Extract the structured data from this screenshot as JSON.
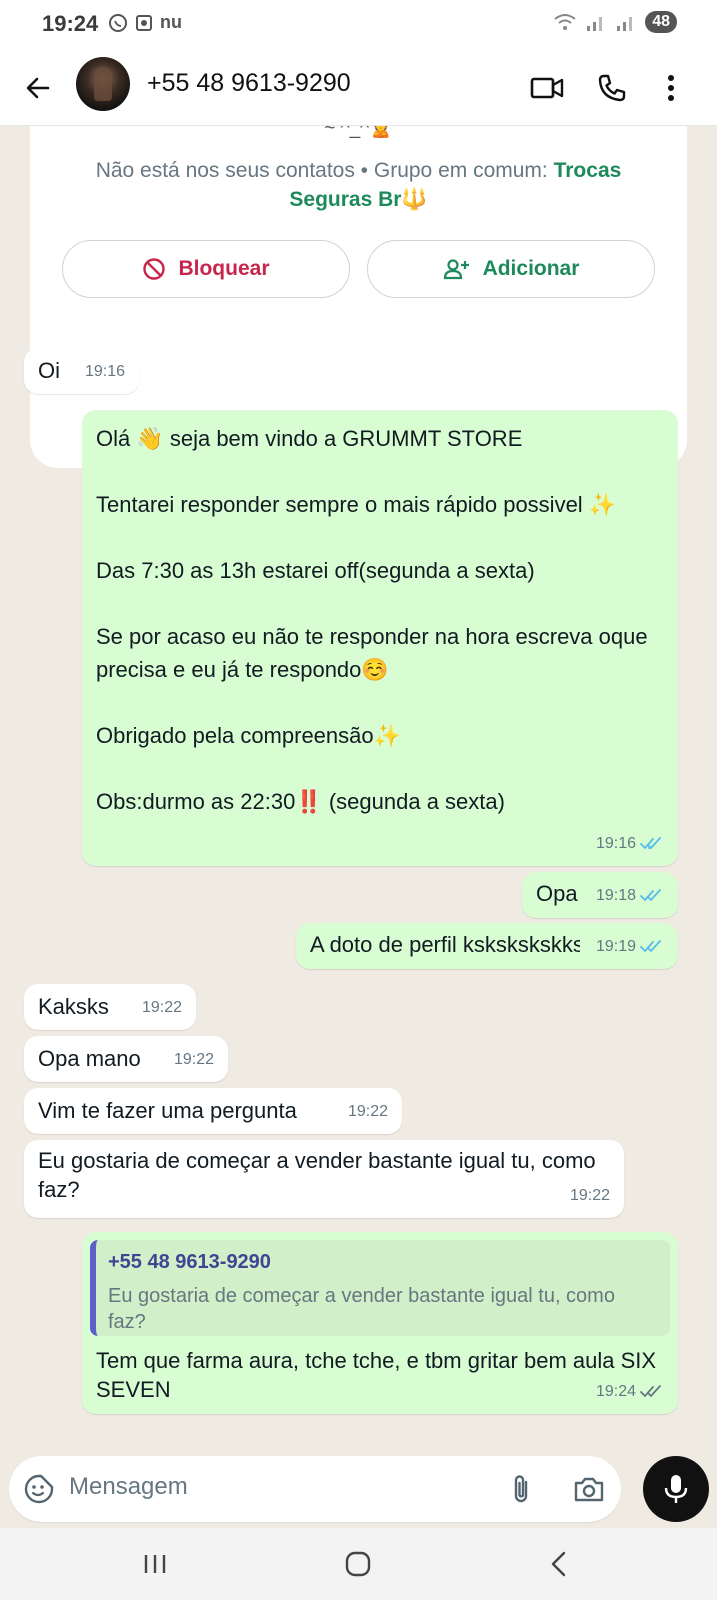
{
  "status_bar": {
    "time": "19:24",
    "carrier_text": "nu",
    "battery": "48"
  },
  "header": {
    "contact_name": "+55 48 9613-9290"
  },
  "info_card": {
    "emoticon": "~ ^_^🙎",
    "not_in_contacts": "Não está nos seus contatos • Grupo em comum: ",
    "group_name": "Trocas Seguras Br🔱",
    "block_label": "Bloquear",
    "add_label": "Adicionar"
  },
  "messages": [
    {
      "dir": "in",
      "text": "Oi",
      "time": "19:16"
    },
    {
      "dir": "out",
      "text": "Olá 👋 seja bem vindo a GRUMMT STORE\n\nTentarei responder sempre o mais rápido possivel ✨\n\nDas 7:30 as 13h estarei off(segunda a sexta)\n\nSe por acaso eu não te responder na hora escreva oque precisa e eu já te respondo☺️\n\nObrigado pela compreensão✨\n\nObs:durmo as 22:30‼️ (segunda a sexta)",
      "time": "19:16",
      "status": "read"
    },
    {
      "dir": "out",
      "text": "Opa",
      "time": "19:18",
      "status": "read"
    },
    {
      "dir": "out",
      "text": "A doto de perfil kskskskskks",
      "time": "19:19",
      "status": "read"
    },
    {
      "dir": "in",
      "text": "Kaksks",
      "time": "19:22"
    },
    {
      "dir": "in",
      "text": "Opa mano",
      "time": "19:22"
    },
    {
      "dir": "in",
      "text": "Vim te fazer uma pergunta",
      "time": "19:22"
    },
    {
      "dir": "in",
      "text": "Eu gostaria de começar a vender bastante igual tu, como faz?",
      "time": "19:22"
    },
    {
      "dir": "out",
      "quote_name": "+55 48 9613-9290",
      "quote_text": "Eu gostaria de começar a vender bastante igual tu, como faz?",
      "text": "Tem que farma aura, tche tche, e tbm gritar bem aula SIX SEVEN",
      "time": "19:24",
      "status": "delivered"
    }
  ],
  "composer": {
    "placeholder": "Mensagem"
  },
  "colors": {
    "incoming": "#ffffff",
    "outgoing": "#d9fdd3",
    "accent": "#1e8a5c",
    "read_tick": "#53bdeb",
    "block": "#c8254b"
  }
}
